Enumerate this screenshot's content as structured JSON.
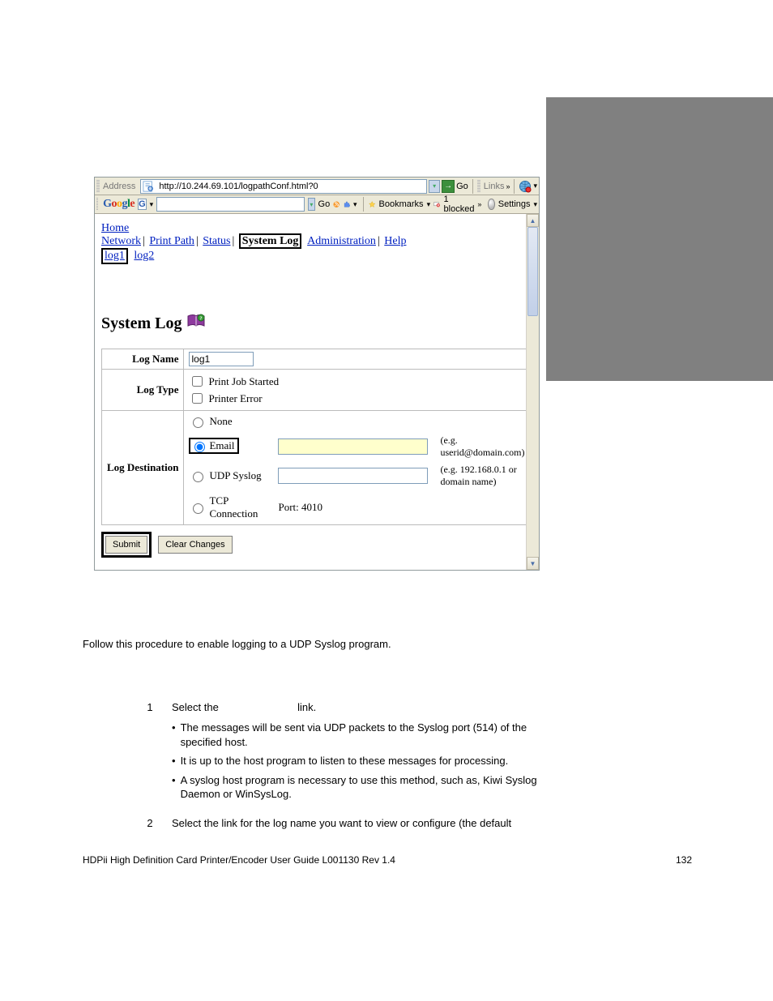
{
  "browser": {
    "address_label": "Address",
    "url": "http://10.244.69.101/logpathConf.html?0",
    "go_label": "Go",
    "links_label": "Links"
  },
  "google_toolbar": {
    "go_label": "Go",
    "bookmarks_label": "Bookmarks",
    "blocked_label": "1 blocked",
    "settings_label": "Settings"
  },
  "nav": {
    "home": "Home",
    "network": "Network",
    "print_path": "Print Path",
    "status": "Status",
    "system_log": "System Log",
    "administration": "Administration",
    "help": "Help",
    "log1": "log1",
    "log2": "log2"
  },
  "page": {
    "heading": "System Log",
    "labels": {
      "log_name": "Log Name",
      "log_type": "Log Type",
      "log_destination": "Log Destination"
    },
    "log_name_value": "log1",
    "log_types": {
      "print_job_started": "Print Job Started",
      "printer_error": "Printer Error"
    },
    "destinations": {
      "none": "None",
      "email": "Email",
      "udp_syslog": "UDP Syslog",
      "tcp_connection": "TCP Connection"
    },
    "hints": {
      "email": "(e.g. userid@domain.com)",
      "udp": "(e.g. 192.168.0.1 or domain name)"
    },
    "port_label": "Port: 4010",
    "buttons": {
      "submit": "Submit",
      "clear": "Clear Changes"
    }
  },
  "doc": {
    "intro": "Follow this procedure to enable logging to a UDP Syslog program.",
    "step_nums": [
      "1",
      "2"
    ],
    "step1_pre": "Select the",
    "step1_post": "link.",
    "bullets": [
      "The messages will be sent via UDP packets to the Syslog port (514) of the specified host.",
      "It is up to the host program to listen to these messages for processing.",
      "A syslog host program is necessary to use this method, such as, Kiwi Syslog Daemon or WinSysLog."
    ],
    "step2": "Select the link for the log name you want to view or configure (the default",
    "footer_left": "HDPii High Definition Card Printer/Encoder User Guide    L001130 Rev 1.4",
    "footer_right": "132"
  }
}
